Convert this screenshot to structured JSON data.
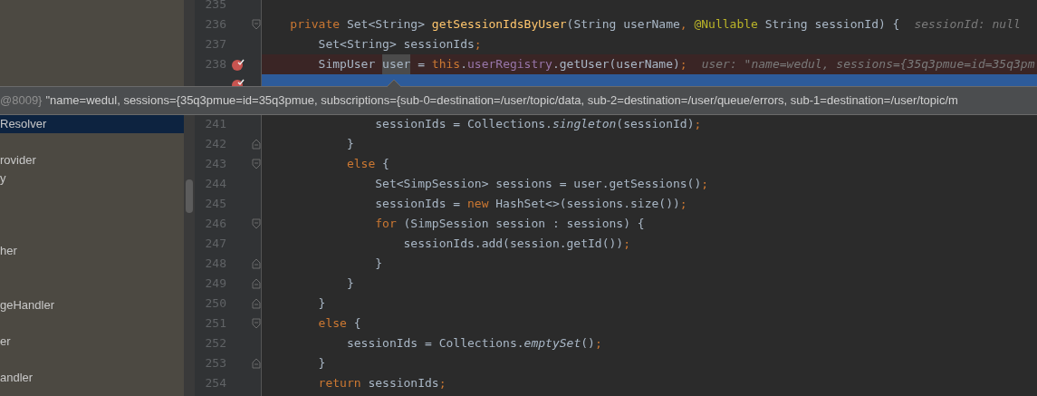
{
  "sidebar": {
    "items": [
      {
        "label": "Resolver",
        "selected": true
      },
      {
        "label": "rovider",
        "selected": false
      },
      {
        "label": "y",
        "selected": false
      },
      {
        "label": "her",
        "selected": false
      },
      {
        "label": "geHandler",
        "selected": false
      },
      {
        "label": "er",
        "selected": false
      },
      {
        "label": "andler",
        "selected": false
      }
    ]
  },
  "editor": {
    "lines": [
      {
        "number": "235",
        "breakpoint": false,
        "current": false,
        "fold_open": false,
        "fold_close": false
      },
      {
        "number": "236",
        "breakpoint": false,
        "current": false,
        "fold_open": true,
        "fold_close": false,
        "tokens": [
          {
            "text": "    private ",
            "kind": "keyword"
          },
          {
            "text": "Set<String> ",
            "kind": "plain"
          },
          {
            "text": "getSessionIdsByUser",
            "kind": "method"
          },
          {
            "text": "(String userName",
            "kind": "plain"
          },
          {
            "text": ", ",
            "kind": "punct"
          },
          {
            "text": "@Nullable ",
            "kind": "annotation"
          },
          {
            "text": "String sessionId) {",
            "kind": "plain"
          },
          {
            "text": "sessionId: null",
            "kind": "hint"
          }
        ]
      },
      {
        "number": "237",
        "breakpoint": false,
        "current": false,
        "fold_open": false,
        "fold_close": false,
        "tokens": [
          {
            "text": "        Set<String> sessionIds",
            "kind": "plain"
          },
          {
            "text": ";",
            "kind": "punct"
          }
        ]
      },
      {
        "number": "238",
        "breakpoint": true,
        "current": false,
        "fold_open": false,
        "fold_close": false,
        "tokens": [
          {
            "text": "        SimpUser ",
            "kind": "plain"
          },
          {
            "text": "user",
            "kind": "highlighted"
          },
          {
            "text": " = ",
            "kind": "plain"
          },
          {
            "text": "this",
            "kind": "keyword"
          },
          {
            "text": ".",
            "kind": "plain"
          },
          {
            "text": "userRegistry",
            "kind": "field"
          },
          {
            "text": ".getUser(userName)",
            "kind": "plain"
          },
          {
            "text": ";",
            "kind": "punct"
          },
          {
            "text": "user: \"name=wedul, sessions={35q3pmue=id=35q3pm",
            "kind": "hint"
          }
        ]
      },
      {
        "breakpoint": true,
        "current": true,
        "fold_open": false,
        "fold_close": false
      },
      {
        "number": "241",
        "breakpoint": false,
        "current": false,
        "fold_open": false,
        "fold_close": false,
        "tokens": [
          {
            "text": "                sessionIds = Collections.",
            "kind": "plain"
          },
          {
            "text": "singleton",
            "kind": "static"
          },
          {
            "text": "(sessionId)",
            "kind": "plain"
          },
          {
            "text": ";",
            "kind": "punct"
          }
        ]
      },
      {
        "number": "242",
        "breakpoint": false,
        "current": false,
        "fold_open": false,
        "fold_close": true,
        "tokens": [
          {
            "text": "            }",
            "kind": "plain"
          }
        ]
      },
      {
        "number": "243",
        "breakpoint": false,
        "current": false,
        "fold_open": true,
        "fold_close": false,
        "tokens": [
          {
            "text": "            else ",
            "kind": "keyword"
          },
          {
            "text": "{",
            "kind": "plain"
          }
        ]
      },
      {
        "number": "244",
        "breakpoint": false,
        "current": false,
        "fold_open": false,
        "fold_close": false,
        "tokens": [
          {
            "text": "                Set<SimpSession> sessions = user.getSessions()",
            "kind": "plain"
          },
          {
            "text": ";",
            "kind": "punct"
          }
        ]
      },
      {
        "number": "245",
        "breakpoint": false,
        "current": false,
        "fold_open": false,
        "fold_close": false,
        "tokens": [
          {
            "text": "                sessionIds = ",
            "kind": "plain"
          },
          {
            "text": "new ",
            "kind": "keyword"
          },
          {
            "text": "HashSet<>(sessions.size())",
            "kind": "plain"
          },
          {
            "text": ";",
            "kind": "punct"
          }
        ]
      },
      {
        "number": "246",
        "breakpoint": false,
        "current": false,
        "fold_open": true,
        "fold_close": false,
        "tokens": [
          {
            "text": "                for ",
            "kind": "keyword"
          },
          {
            "text": "(SimpSession session : sessions) {",
            "kind": "plain"
          }
        ]
      },
      {
        "number": "247",
        "breakpoint": false,
        "current": false,
        "fold_open": false,
        "fold_close": false,
        "tokens": [
          {
            "text": "                    sessionIds.add(session.getId())",
            "kind": "plain"
          },
          {
            "text": ";",
            "kind": "punct"
          }
        ]
      },
      {
        "number": "248",
        "breakpoint": false,
        "current": false,
        "fold_open": false,
        "fold_close": true,
        "tokens": [
          {
            "text": "                }",
            "kind": "plain"
          }
        ]
      },
      {
        "number": "249",
        "breakpoint": false,
        "current": false,
        "fold_open": false,
        "fold_close": true,
        "tokens": [
          {
            "text": "            }",
            "kind": "plain"
          }
        ]
      },
      {
        "number": "250",
        "breakpoint": false,
        "current": false,
        "fold_open": false,
        "fold_close": true,
        "tokens": [
          {
            "text": "        }",
            "kind": "plain"
          }
        ]
      },
      {
        "number": "251",
        "breakpoint": false,
        "current": false,
        "fold_open": true,
        "fold_close": false,
        "tokens": [
          {
            "text": "        else ",
            "kind": "keyword"
          },
          {
            "text": "{",
            "kind": "plain"
          }
        ]
      },
      {
        "number": "252",
        "breakpoint": false,
        "current": false,
        "fold_open": false,
        "fold_close": false,
        "tokens": [
          {
            "text": "            sessionIds = Collections.",
            "kind": "plain"
          },
          {
            "text": "emptySet",
            "kind": "static"
          },
          {
            "text": "()",
            "kind": "plain"
          },
          {
            "text": ";",
            "kind": "punct"
          }
        ]
      },
      {
        "number": "253",
        "breakpoint": false,
        "current": false,
        "fold_open": false,
        "fold_close": true,
        "tokens": [
          {
            "text": "        }",
            "kind": "plain"
          }
        ]
      },
      {
        "number": "254",
        "breakpoint": false,
        "current": false,
        "fold_open": false,
        "fold_close": false,
        "tokens": [
          {
            "text": "        return ",
            "kind": "keyword"
          },
          {
            "text": "sessionIds",
            "kind": "plain"
          },
          {
            "text": ";",
            "kind": "punct"
          }
        ]
      }
    ]
  },
  "tooltip": {
    "prefix": "@8009}",
    "text": "\"name=wedul, sessions={35q3pmue=id=35q3pmue, subscriptions={sub-0=destination=/user/topic/data, sub-2=destination=/user/queue/errors, sub-1=destination=/user/topic/m"
  }
}
